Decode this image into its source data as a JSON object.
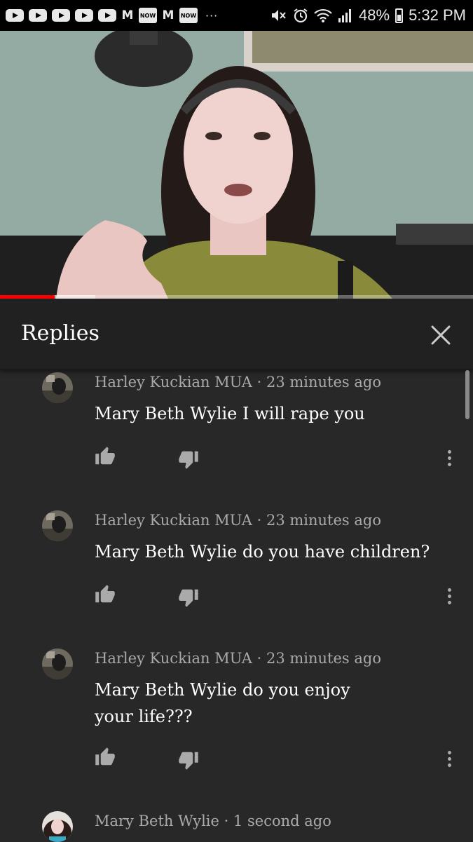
{
  "status_bar": {
    "notification_icons": [
      "youtube-icon",
      "youtube-icon",
      "youtube-icon",
      "youtube-icon",
      "youtube-icon",
      "gmail-icon",
      "now-icon",
      "gmail-icon",
      "now-icon"
    ],
    "now_label": "NOW",
    "gmail_label": "M",
    "overflow": "···",
    "battery": "48%",
    "time": "5:32 PM"
  },
  "video": {
    "progress_fraction": 0.115,
    "colors": {
      "progress": "#ff0000",
      "wall": "#93aba3"
    }
  },
  "replies_panel": {
    "title": "Replies",
    "close_icon": "close-icon"
  },
  "comments": [
    {
      "author": "Harley Kuckian MUA",
      "time": "23 minutes ago",
      "text": "Mary Beth Wylie I will rape you"
    },
    {
      "author": "Harley Kuckian MUA",
      "time": "23 minutes ago",
      "text": "Mary Beth Wylie do you have children?"
    },
    {
      "author": "Harley Kuckian MUA",
      "time": "23 minutes ago",
      "text": "Mary Beth Wylie do you enjoy your life???"
    },
    {
      "author": "Mary Beth Wylie",
      "time": "1 second ago",
      "text": ""
    }
  ],
  "icons": {
    "like": "thumbs-up-icon",
    "dislike": "thumbs-down-icon",
    "menu": "more-vert-icon"
  }
}
